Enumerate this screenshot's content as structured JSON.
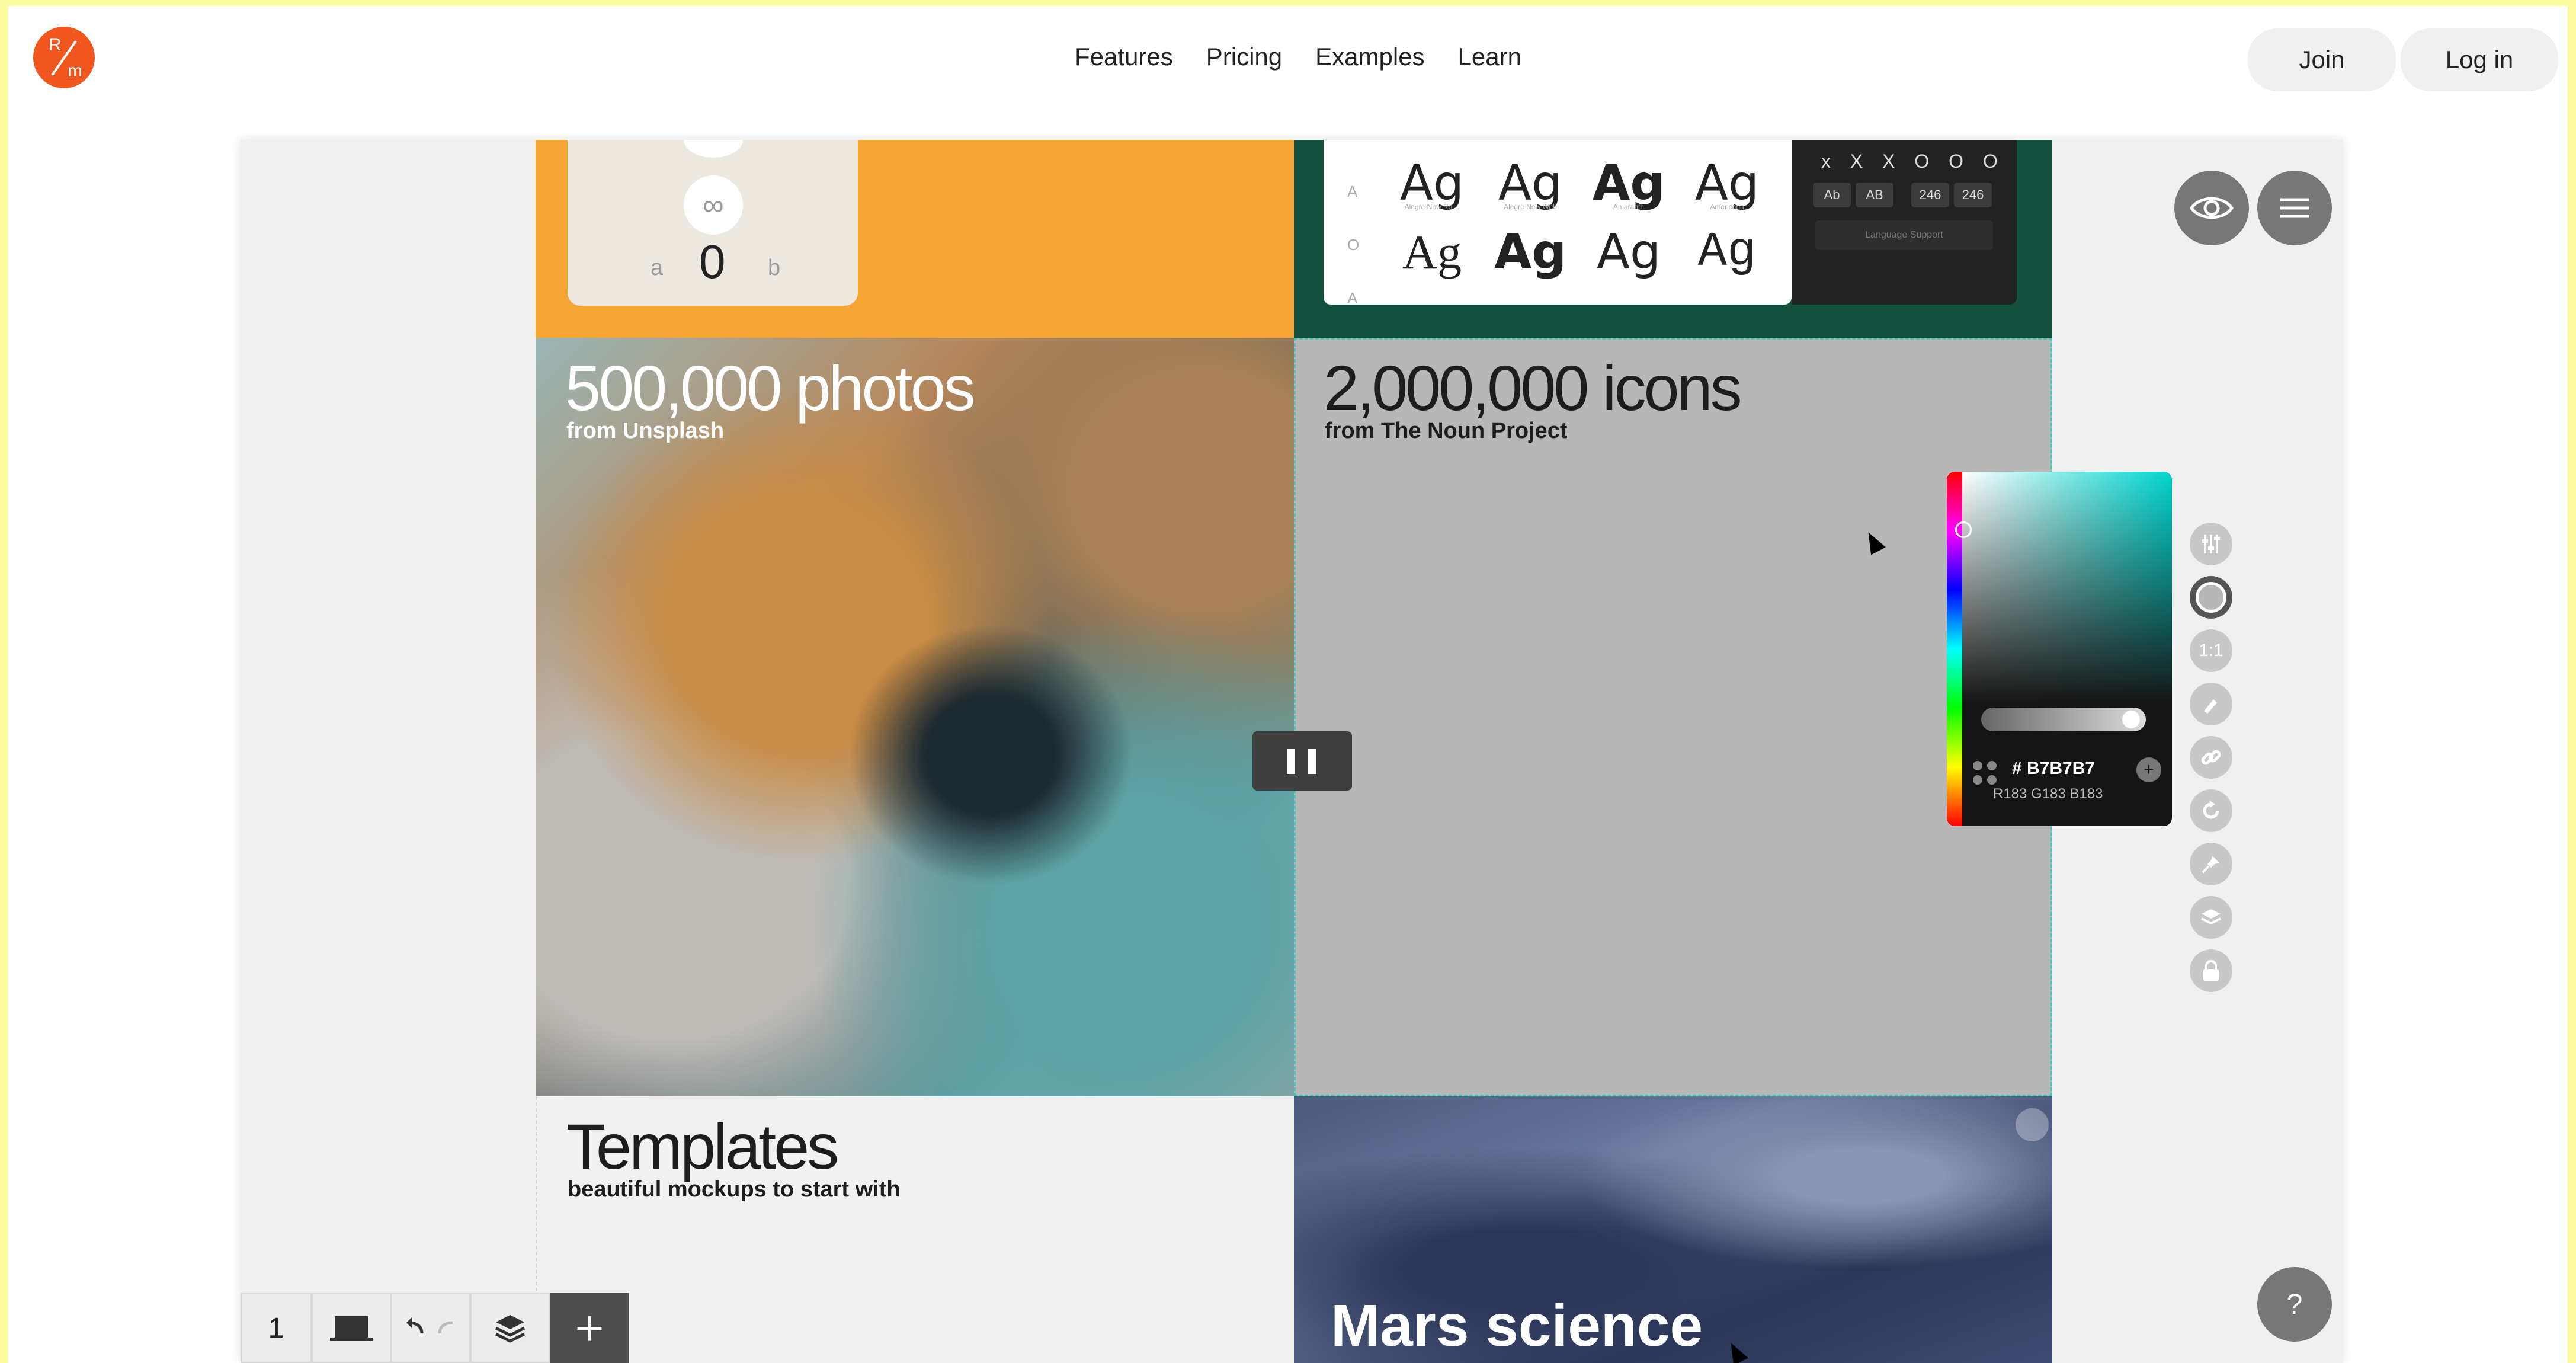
{
  "logo": {
    "r": "R",
    "m": "m"
  },
  "nav": {
    "items": [
      "Features",
      "Pricing",
      "Examples",
      "Learn"
    ]
  },
  "auth": {
    "join": "Join",
    "login": "Log in"
  },
  "ruler": {
    "a": "a",
    "b": "b",
    "value": "0",
    "inf": "∞"
  },
  "fonts": {
    "side": [
      "A",
      "O",
      "A"
    ],
    "samples": [
      {
        "glyph": "Ag",
        "name": "Alegre New Ro…"
      },
      {
        "glyph": "Ag",
        "name": "Alegre New Web"
      },
      {
        "glyph": "Ag",
        "name": "Amaranth"
      },
      {
        "glyph": "Ag",
        "name": "Americana"
      },
      {
        "glyph": "Ag",
        "name": ""
      },
      {
        "glyph": "Ag",
        "name": ""
      },
      {
        "glyph": "Ag",
        "name": ""
      },
      {
        "glyph": "Ag",
        "name": ""
      }
    ],
    "dark_row1": "x X X  O O O",
    "chips": [
      "Ab",
      "AB",
      "246",
      "246"
    ],
    "language_select": "Language Support"
  },
  "photos": {
    "title": "500,000 photos",
    "subtitle": "from Unsplash"
  },
  "icons": {
    "title": "2,000,000 icons",
    "subtitle": "from The Noun Project"
  },
  "templates": {
    "title": "Templates",
    "subtitle": "beautiful mockups to start with"
  },
  "mars": {
    "title": "Mars science"
  },
  "picker": {
    "hex": "# B7B7B7",
    "rgb": "R183 G183 B183",
    "add": "+"
  },
  "tools": [
    "adjust-icon",
    "fill-color-icon",
    "aspect-ratio-icon",
    "brush-icon",
    "link-icon",
    "rotate-icon",
    "pin-icon",
    "layers-icon",
    "lock-icon"
  ],
  "tool_text": {
    "ratio": "1:1"
  },
  "bottombar": {
    "page": "1",
    "add": "+"
  },
  "help": "?",
  "colors": {
    "accent": "#f0561d",
    "page_bg": "#fbfba0",
    "orange_cell": "#f5a534",
    "green_cell": "#14503e",
    "gray_cell": "#b7b7b7"
  }
}
